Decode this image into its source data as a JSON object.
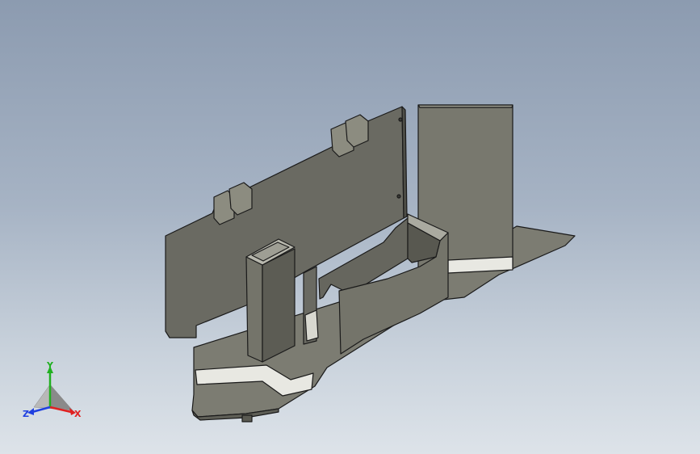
{
  "viewport": {
    "background_top": "#8c9bb0",
    "background_bottom": "#dde3e9"
  },
  "model": {
    "face_light": "#8a8a7e",
    "face_mid": "#6e6e64",
    "face_dark": "#55554d",
    "edge": "#1a1a1a",
    "highlight": "#e8e8e2"
  },
  "triad": {
    "x_label": "X",
    "y_label": "Y",
    "z_label": "Z",
    "x_color": "#e02020",
    "y_color": "#20b020",
    "z_color": "#2040e0"
  }
}
